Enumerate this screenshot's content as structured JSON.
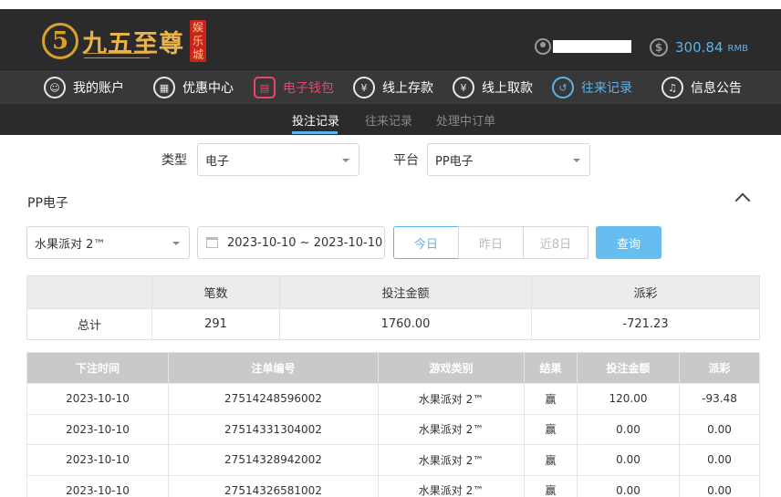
{
  "header": {
    "logo_digit": "5",
    "logo_text": "九五至尊",
    "logo_badge": "娱乐城",
    "balance": "300.84",
    "currency": "RMB"
  },
  "nav": [
    {
      "label": "我的账户",
      "icon": "user-icon"
    },
    {
      "label": "优惠中心",
      "icon": "gift-icon"
    },
    {
      "label": "电子钱包",
      "icon": "wallet-icon"
    },
    {
      "label": "线上存款",
      "icon": "deposit-icon"
    },
    {
      "label": "线上取款",
      "icon": "withdraw-icon"
    },
    {
      "label": "往来记录",
      "icon": "records-icon"
    },
    {
      "label": "信息公告",
      "icon": "bell-icon"
    }
  ],
  "subnav": [
    "投注记录",
    "往来记录",
    "处理中订单"
  ],
  "filters": {
    "type_label": "类型",
    "type_value": "电子",
    "platform_label": "平台",
    "platform_value": "PP电子",
    "section_title": "PP电子",
    "game_value": "水果派对 2™",
    "date_range": "2023-10-10 ~ 2023-10-10",
    "quick_today": "今日",
    "quick_yesterday": "昨日",
    "quick_8days": "近8日",
    "query_button": "查询"
  },
  "summary": {
    "headers": [
      "",
      "笔数",
      "投注金额",
      "派彩"
    ],
    "row": {
      "label": "总计",
      "count": "291",
      "amount": "1760.00",
      "payout": "-721.23"
    }
  },
  "records": {
    "headers": [
      "下注时间",
      "注单编号",
      "游戏类别",
      "结果",
      "投注金额",
      "派彩"
    ],
    "rows": [
      {
        "time": "2023-10-10",
        "id": "27514248596002",
        "game": "水果派对 2™",
        "result": "赢",
        "amount": "120.00",
        "payout": "-93.48"
      },
      {
        "time": "2023-10-10",
        "id": "27514331304002",
        "game": "水果派对 2™",
        "result": "赢",
        "amount": "0.00",
        "payout": "0.00"
      },
      {
        "time": "2023-10-10",
        "id": "27514328942002",
        "game": "水果派对 2™",
        "result": "赢",
        "amount": "0.00",
        "payout": "0.00"
      },
      {
        "time": "2023-10-10",
        "id": "27514326581002",
        "game": "水果派对 2™",
        "result": "赢",
        "amount": "0.00",
        "payout": "0.00"
      }
    ]
  },
  "colors": {
    "accent": "#5bb4ec",
    "wallet_active": "#e9456a",
    "negative": "#e2454f"
  }
}
